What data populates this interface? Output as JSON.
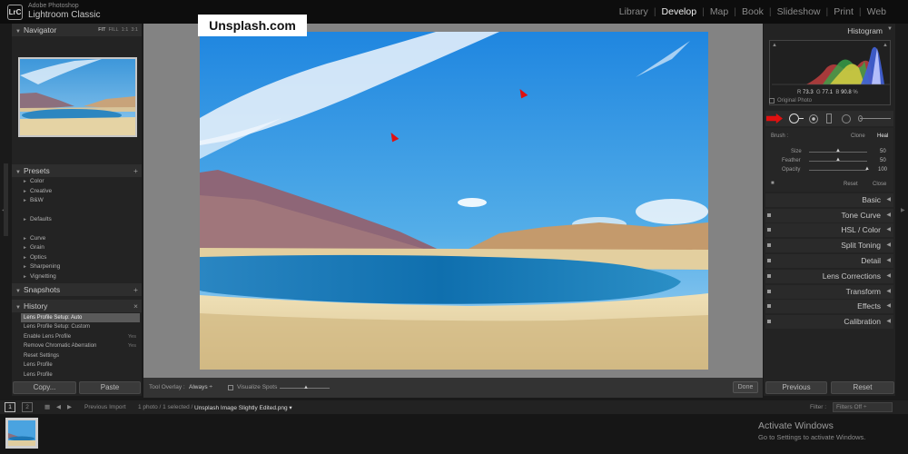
{
  "app": {
    "brand_top": "Adobe Photoshop",
    "brand_main": "Lightroom Classic",
    "logo": "LrC"
  },
  "modules": [
    "Library",
    "Develop",
    "Map",
    "Book",
    "Slideshow",
    "Print",
    "Web"
  ],
  "active_module": "Develop",
  "navigator": {
    "title": "Navigator",
    "options": [
      "FIT",
      "FILL",
      "1:1",
      "3:1"
    ]
  },
  "presets": {
    "title": "Presets",
    "groups": [
      "Color",
      "Creative",
      "B&W",
      "Defaults",
      "Curve",
      "Grain",
      "Optics",
      "Sharpening",
      "Vignetting"
    ]
  },
  "snapshots": {
    "title": "Snapshots"
  },
  "history": {
    "title": "History",
    "items": [
      {
        "label": "Lens Profile Setup: Auto",
        "value": ""
      },
      {
        "label": "Lens Profile Setup: Custom",
        "value": ""
      },
      {
        "label": "Enable Lens Profile",
        "value": "Yes"
      },
      {
        "label": "Remove Chromatic Aberration",
        "value": "Yes"
      },
      {
        "label": "Reset Settings",
        "value": ""
      },
      {
        "label": "Lens Profile",
        "value": ""
      },
      {
        "label": "Lens Profile",
        "value": ""
      }
    ]
  },
  "left_buttons": {
    "copy": "Copy...",
    "paste": "Paste"
  },
  "watermark": "Unsplash.com",
  "toolbar": {
    "tool_overlay_label": "Tool Overlay :",
    "tool_overlay_value": "Always",
    "visualize_spots": "Visualize Spots",
    "done": "Done"
  },
  "histogram": {
    "title": "Histogram",
    "readout": {
      "R": "73.3",
      "G": "77.1",
      "B": "90.8",
      "unit": "%"
    },
    "original_photo": "Original Photo"
  },
  "spot_removal": {
    "brush_label": "Brush :",
    "clone": "Clone",
    "heal": "Heal",
    "sliders": [
      {
        "name": "Size",
        "value": "50",
        "fraction": 0.5
      },
      {
        "name": "Feather",
        "value": "50",
        "fraction": 0.5
      },
      {
        "name": "Opacity",
        "value": "100",
        "fraction": 1.0
      }
    ],
    "reset": "Reset",
    "close": "Close"
  },
  "right_panels": [
    "Basic",
    "Tone Curve",
    "HSL / Color",
    "Split Toning",
    "Detail",
    "Lens Corrections",
    "Transform",
    "Effects",
    "Calibration"
  ],
  "right_buttons": {
    "previous": "Previous",
    "reset": "Reset"
  },
  "filmbar": {
    "page1": "1",
    "page2": "2",
    "source": "Previous Import",
    "count": "1 photo / 1 selected /",
    "filename": "Unsplash Image Slightly Edited.png",
    "filter_label": "Filter :",
    "filter_value": "Filters Off"
  },
  "activation": {
    "title": "Activate Windows",
    "subtitle": "Go to Settings to activate Windows."
  },
  "colors": {
    "accent_marker": "#e01010",
    "panel_bg": "#232323",
    "canvas_bg": "#838383"
  }
}
